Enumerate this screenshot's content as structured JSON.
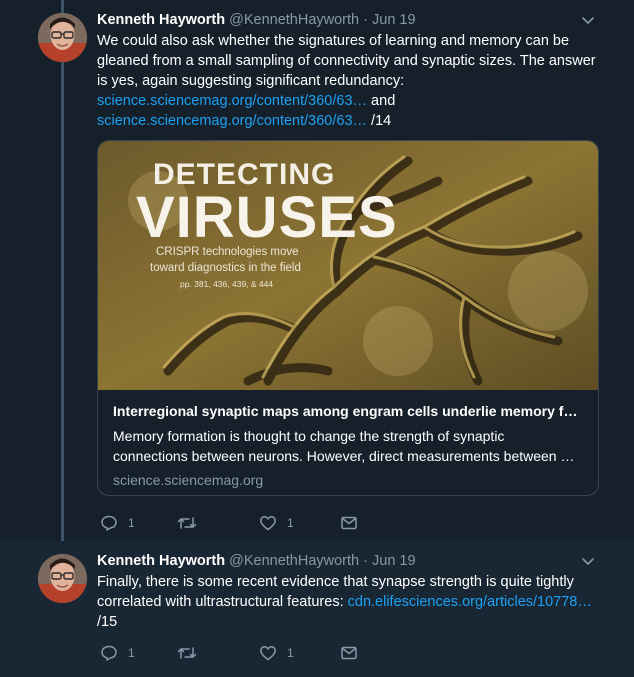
{
  "tweets": [
    {
      "author_name": "Kenneth Hayworth",
      "author_handle": "@KennethHayworth",
      "separator": "·",
      "date": "Jun 19",
      "text_intro": "We could also ask whether the signatures of learning and memory can be gleaned from a small sampling of connectivity and synaptic sizes. The answer is yes, again suggesting significant redundancy:",
      "link_1": "science.sciencemag.org/content/360/63…",
      "connector": " and",
      "link_2": "science.sciencemag.org/content/360/63…",
      "suffix": " /14",
      "card": {
        "cover_headline_1": "DETECTING",
        "cover_headline_2": "VIRUSES",
        "cover_sub_1": "CRISPR technologies move",
        "cover_sub_2": "toward diagnostics in the field",
        "cover_pages": "pp. 381, 436, 439, & 444",
        "title": "Interregional synaptic maps among engram cells underlie memory f…",
        "description": "Memory formation is thought to change the strength of synaptic connections between neurons. However, direct measurements between …",
        "domain": "science.sciencemag.org"
      },
      "actions": {
        "replies": "1",
        "retweets": "",
        "likes": "1"
      }
    },
    {
      "author_name": "Kenneth Hayworth",
      "author_handle": "@KennethHayworth",
      "separator": "·",
      "date": "Jun 19",
      "text_intro": "Finally, there is some recent evidence that synapse strength is quite tightly correlated with ultrastructural features:",
      "link_1": "cdn.elifesciences.org/articles/10778…",
      "suffix": "/15",
      "actions": {
        "replies": "1",
        "retweets": "",
        "likes": "1"
      }
    }
  ],
  "icons": {
    "reply": "reply-icon",
    "retweet": "retweet-icon",
    "like": "heart-icon",
    "message": "envelope-icon",
    "menu": "chevron-down-icon"
  },
  "colors": {
    "background": "#15202b",
    "highlight_background": "#192734",
    "link": "#1da1f2",
    "muted": "#8899a6",
    "thread_line": "#3d5466"
  }
}
